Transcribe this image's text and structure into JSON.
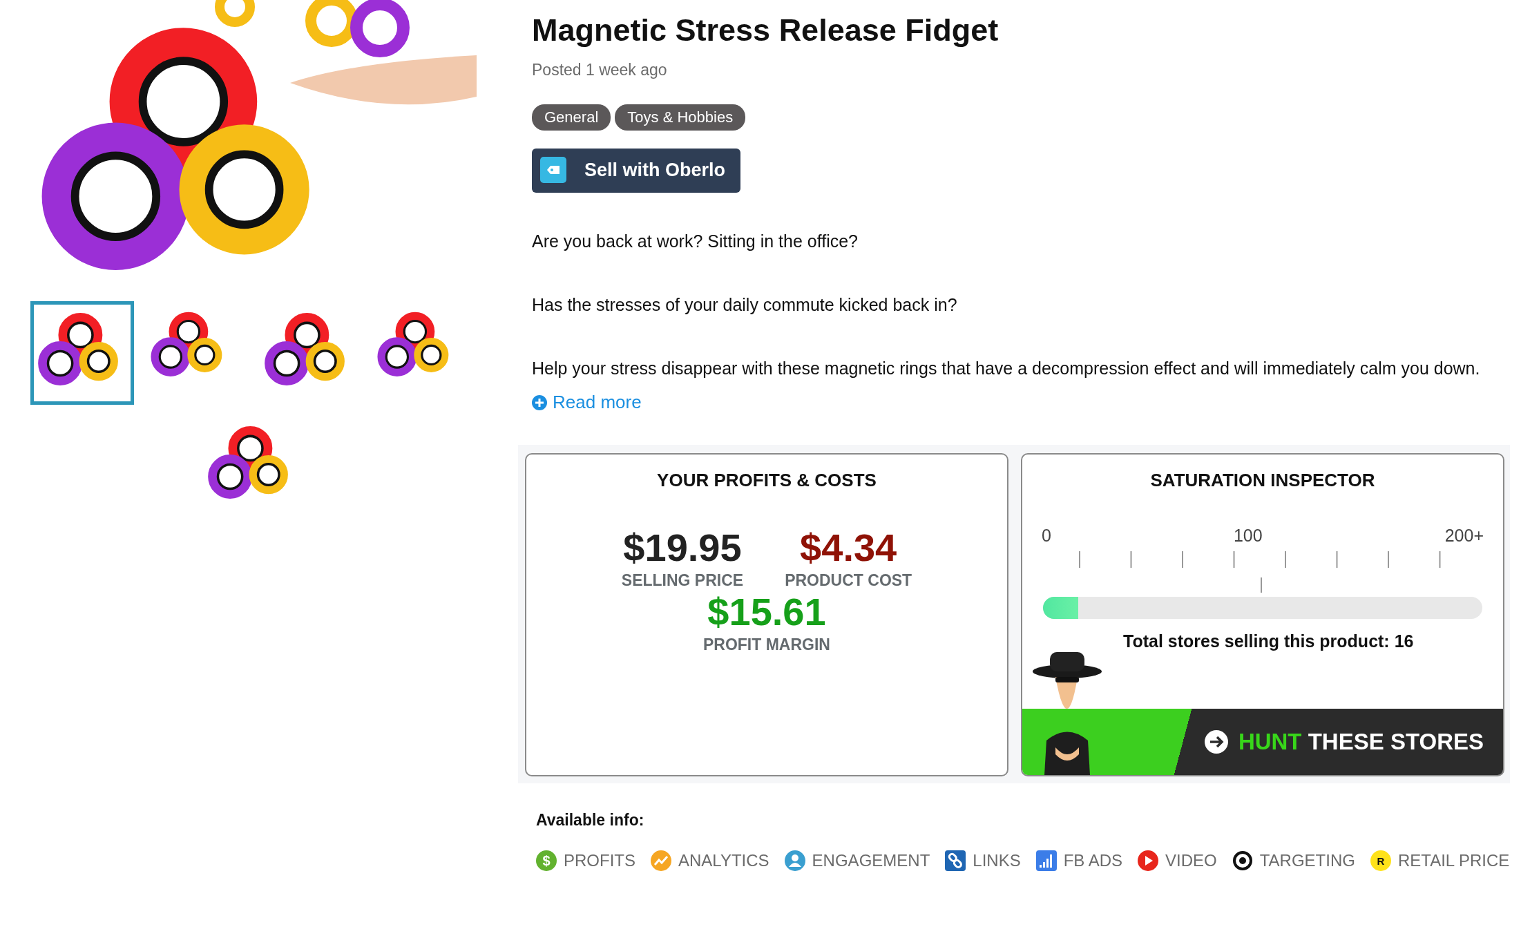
{
  "gallery": {
    "thumbnails": [
      {
        "selected": true
      },
      {
        "selected": false
      },
      {
        "selected": false
      },
      {
        "selected": false
      },
      {
        "selected": false
      }
    ]
  },
  "product": {
    "title": "Magnetic Stress Release Fidget",
    "posted": "Posted 1 week ago",
    "tags": [
      "General",
      "Toys & Hobbies"
    ],
    "sell_button": "Sell with Oberlo",
    "description": [
      "Are you back at work? Sitting in the office?",
      "Has the stresses of your daily commute kicked back in?",
      "Help your stress disappear with these magnetic rings that have a decompression effect and will immediately calm you down."
    ],
    "read_more": "Read more"
  },
  "profits": {
    "title": "YOUR PROFITS & COSTS",
    "figures": [
      {
        "kind": "price",
        "value": "$19.95",
        "label": "SELLING PRICE"
      },
      {
        "kind": "cost",
        "value": "$4.34",
        "label": "PRODUCT COST"
      },
      {
        "kind": "margin",
        "value": "$15.61",
        "label": "PROFIT MARGIN"
      }
    ]
  },
  "saturation": {
    "title": "SATURATION INSPECTOR",
    "scale": [
      "0",
      "100",
      "200+"
    ],
    "level": 0.08,
    "total": "Total stores selling this product: 16",
    "hunt_button": {
      "accent": "HUNT",
      "text": "THESE STORES"
    }
  },
  "available_info": {
    "heading": "Available info:",
    "items": [
      {
        "kind": "dollar",
        "glyph": "$",
        "label": "PROFITS"
      },
      {
        "kind": "analytics",
        "label": "ANALYTICS"
      },
      {
        "kind": "user",
        "label": "ENGAGEMENT"
      },
      {
        "kind": "link",
        "label": "LINKS"
      },
      {
        "kind": "bars",
        "label": "FB ADS"
      },
      {
        "kind": "play",
        "label": "VIDEO"
      },
      {
        "kind": "target",
        "label": "TARGETING"
      },
      {
        "kind": "coin",
        "glyph": "R",
        "label": "RETAIL PRICE"
      }
    ]
  }
}
